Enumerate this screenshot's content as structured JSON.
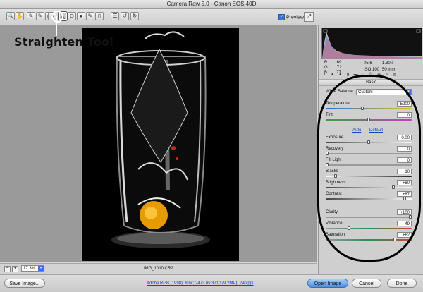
{
  "window": {
    "title": "Camera Raw 5.0  -  Canon EOS 40D"
  },
  "toolbar": {
    "tools": [
      {
        "name": "zoom-tool-icon",
        "glyph": "🔍"
      },
      {
        "name": "hand-tool-icon",
        "glyph": "✋"
      },
      {
        "name": "white-balance-tool-icon",
        "glyph": "✎"
      },
      {
        "name": "color-sampler-tool-icon",
        "glyph": "✎"
      },
      {
        "name": "targeted-adjustment-tool-icon",
        "glyph": "◎"
      },
      {
        "name": "crop-tool-icon",
        "glyph": "⌗"
      },
      {
        "name": "straighten-tool-icon",
        "glyph": "△"
      },
      {
        "name": "spot-removal-tool-icon",
        "glyph": "⊙"
      },
      {
        "name": "red-eye-tool-icon",
        "glyph": "●"
      },
      {
        "name": "adjustment-brush-icon",
        "glyph": "✎"
      },
      {
        "name": "graduated-filter-icon",
        "glyph": "▯"
      },
      {
        "name": "preferences-icon",
        "glyph": "☰"
      },
      {
        "name": "rotate-ccw-icon",
        "glyph": "↺"
      },
      {
        "name": "rotate-cw-icon",
        "glyph": "↻"
      }
    ],
    "preview_label": "Preview",
    "preview_checked": true
  },
  "annotation": {
    "label": "Straighten Tool"
  },
  "status": {
    "zoom": "17.3%",
    "filename": "IMG_1010.CR2"
  },
  "readout": {
    "r_label": "R:",
    "r": "69",
    "g_label": "G:",
    "g": "72",
    "b_label": "B:",
    "b": "77",
    "aperture": "f/5.6",
    "shutter": "1.30 s",
    "iso": "ISO 100",
    "focal": "50 mm"
  },
  "panel": {
    "section": "Basic",
    "white_balance_label": "White Balance:",
    "white_balance_value": "Custom",
    "auto_link": "Auto",
    "default_link": "Default",
    "adjustments": [
      {
        "key": "temperature",
        "label": "Temperature",
        "value": "5200",
        "level": 0.42,
        "track": "#2c6fd6,#e0c020"
      },
      {
        "key": "tint",
        "label": "Tint",
        "value": "0",
        "level": 0.5,
        "track": "#3da03d,#c040c0"
      },
      {
        "key": "exposure",
        "label": "Exposure",
        "value": "0.00",
        "level": 0.5,
        "track": "#444,#fff"
      },
      {
        "key": "recovery",
        "label": "Recovery",
        "value": "0",
        "level": 0.0,
        "track": "#9a9a9a,#9a9a9a"
      },
      {
        "key": "fill-light",
        "label": "Fill Light",
        "value": "0",
        "level": 0.0,
        "track": "#9a9a9a,#9a9a9a"
      },
      {
        "key": "blacks",
        "label": "Blacks",
        "value": "10",
        "level": 0.1,
        "track": "#fff,#222"
      },
      {
        "key": "brightness",
        "label": "Brightness",
        "value": "+80",
        "level": 0.8,
        "track": "#444,#fff"
      },
      {
        "key": "contrast",
        "label": "Contrast",
        "value": "+87",
        "level": 0.93,
        "track": "#444,#fff"
      },
      {
        "key": "clarity",
        "label": "Clarity",
        "value": "+100",
        "level": 1.0,
        "track": "#9a9a9a,#9a9a9a"
      },
      {
        "key": "vibrance",
        "label": "Vibrance",
        "value": "-49",
        "level": 0.26,
        "track": "#999,#2a8f5a,#c64b3a"
      },
      {
        "key": "saturation",
        "label": "Saturation",
        "value": "+62",
        "level": 0.81,
        "track": "#999,#2a8f5a,#c64b3a"
      }
    ]
  },
  "bottom": {
    "save_label": "Save Image...",
    "workflow": "Adobe RGB (1998); 8 bit; 2473 by 3710 (9.2MP); 240 ppi",
    "open_label": "Open Image",
    "cancel_label": "Cancel",
    "done_label": "Done"
  },
  "colors": {
    "accent": "#3a74d8",
    "photo_bg": "#000000",
    "lemon": "#f0a800"
  }
}
